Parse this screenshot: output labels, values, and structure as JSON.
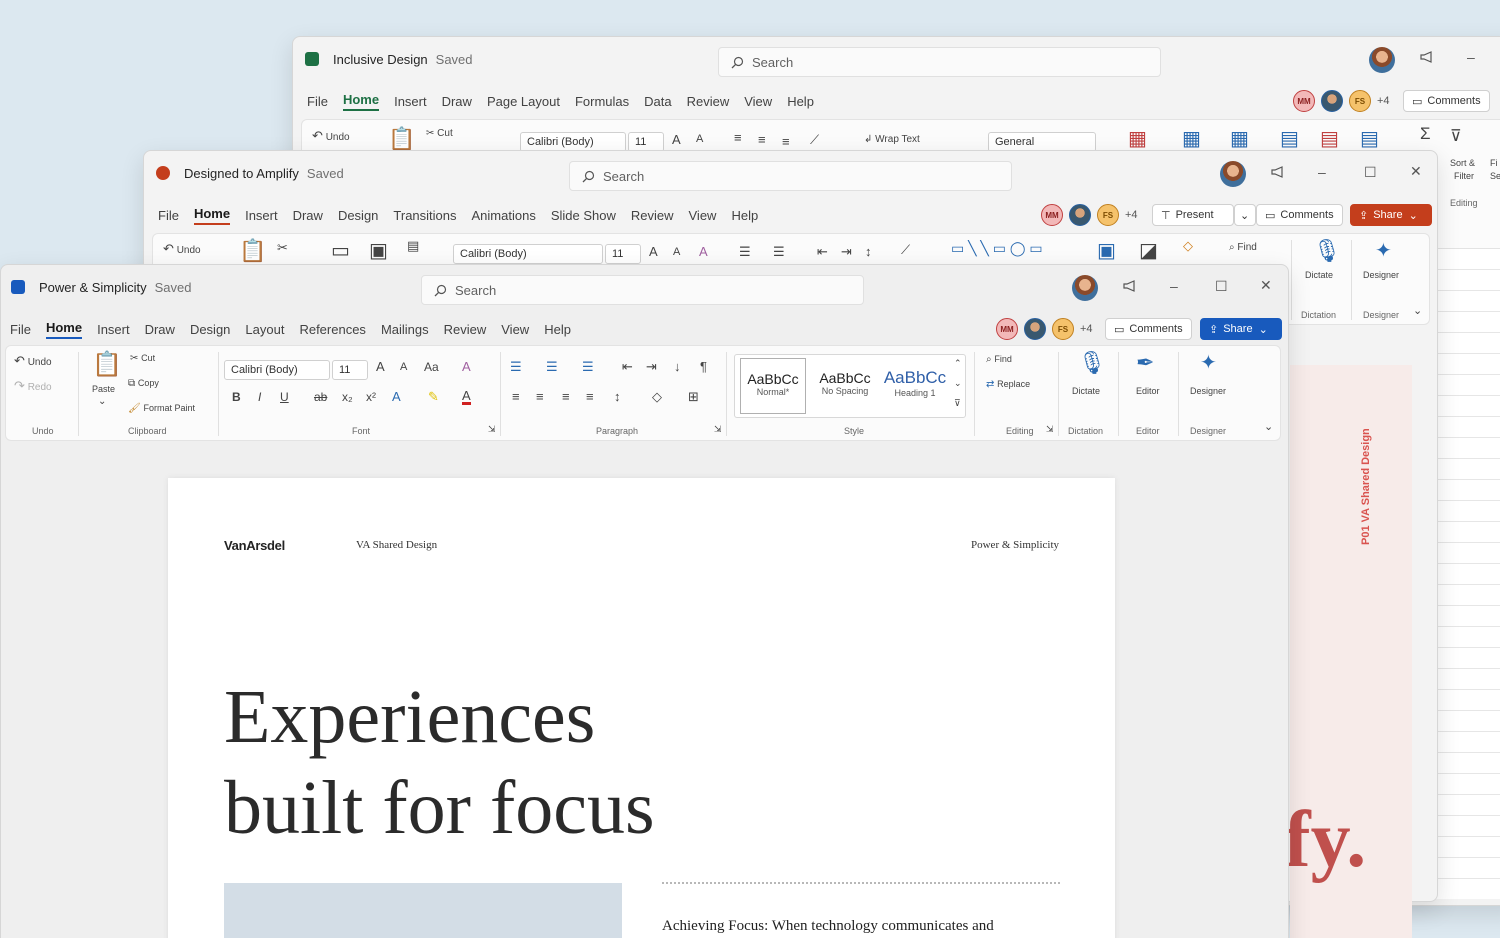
{
  "excel": {
    "title": "Inclusive Design",
    "saved": "Saved",
    "search": "Search",
    "menu": [
      "File",
      "Home",
      "Insert",
      "Draw",
      "Page Layout",
      "Formulas",
      "Data",
      "Review",
      "View",
      "Help"
    ],
    "collab": [
      "MM",
      "FS"
    ],
    "plus": "+4",
    "comments": "Comments",
    "ribbon": {
      "undo": "Undo",
      "cut": "Cut",
      "font": "Calibri (Body)",
      "size": "11",
      "wrap": "Wrap Text",
      "number_format": "General",
      "sort": "Sort &",
      "filter": "Filter",
      "editing": "Editing",
      "fi": "Fi",
      "se": "Se"
    }
  },
  "ppt": {
    "title": "Designed to Amplify",
    "saved": "Saved",
    "search": "Search",
    "menu": [
      "File",
      "Home",
      "Insert",
      "Draw",
      "Design",
      "Transitions",
      "Animations",
      "Slide Show",
      "Review",
      "View",
      "Help"
    ],
    "collab": [
      "MM",
      "FS"
    ],
    "plus": "+4",
    "present": "Present",
    "comments": "Comments",
    "share": "Share",
    "ribbon": {
      "undo": "Undo",
      "font": "Calibri (Body)",
      "size": "11",
      "find": "Find",
      "dictate": "Dictate",
      "designer": "Designer",
      "dictation": "Dictation",
      "designer_grp": "Designer"
    }
  },
  "word": {
    "title": "Power & Simplicity",
    "saved": "Saved",
    "search": "Search",
    "menu": [
      "File",
      "Home",
      "Insert",
      "Draw",
      "Design",
      "Layout",
      "References",
      "Mailings",
      "Review",
      "View",
      "Help"
    ],
    "collab": [
      "MM",
      "FS"
    ],
    "plus": "+4",
    "comments": "Comments",
    "share": "Share",
    "ribbon": {
      "undo": "Undo",
      "redo": "Redo",
      "paste": "Paste",
      "cut": "Cut",
      "copy": "Copy",
      "format_paint": "Format Paint",
      "font": "Calibri (Body)",
      "size": "11",
      "styles": [
        {
          "sample": "AaBbCc",
          "name": "Normal*"
        },
        {
          "sample": "AaBbCc",
          "name": "No Spacing"
        },
        {
          "sample": "AaBbCc",
          "name": "Heading 1"
        }
      ],
      "find": "Find",
      "replace": "Replace",
      "dictate": "Dictate",
      "editor": "Editor",
      "designer": "Designer",
      "groups": {
        "undo": "Undo",
        "clipboard": "Clipboard",
        "font": "Font",
        "paragraph": "Paragraph",
        "style": "Style",
        "editing": "Editing",
        "dictation": "Dictation",
        "editor": "Editor",
        "designer": "Designer"
      }
    }
  },
  "document": {
    "logo": "VanArsdel",
    "header_left": "VA Shared Design",
    "header_right": "Power & Simplicity",
    "headline_line1": "Experiences",
    "headline_line2": "built for focus",
    "subhead": "Achieving Focus: When technology communicates and"
  },
  "side_slide": {
    "vertical_text": "P01   VA Shared Design",
    "big_text": "fy."
  },
  "colors": {
    "word_blue": "#185abd",
    "excel_green": "#1d7044",
    "ppt_orange": "#c43e1c",
    "slide_red": "#d9534f"
  }
}
